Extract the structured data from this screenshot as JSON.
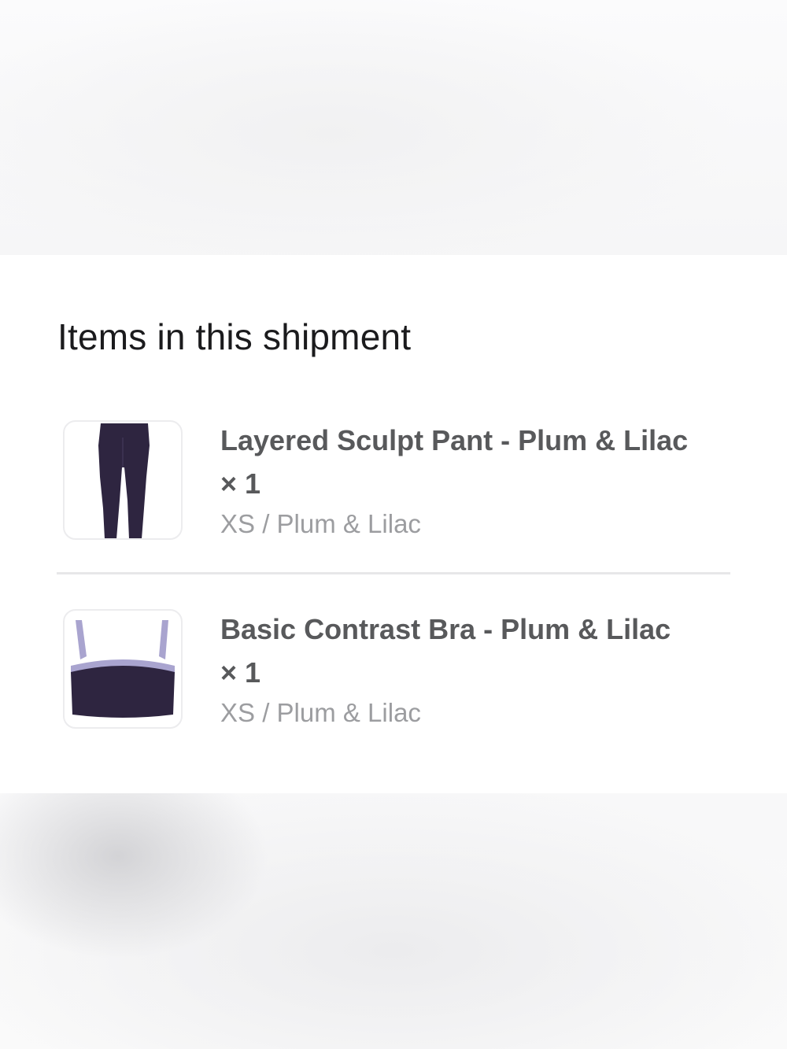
{
  "shipment": {
    "title": "Items in this shipment",
    "items": [
      {
        "name": "Layered Sculpt Pant - Plum & Lilac × 1",
        "variant": "XS / Plum & Lilac",
        "image_icon": "leggings-image"
      },
      {
        "name": "Basic Contrast Bra - Plum & Lilac × 1",
        "variant": "XS / Plum & Lilac",
        "image_icon": "sports-bra-image"
      }
    ]
  },
  "colors": {
    "plum": "#2e2540",
    "lilac": "#a9a4cf"
  }
}
